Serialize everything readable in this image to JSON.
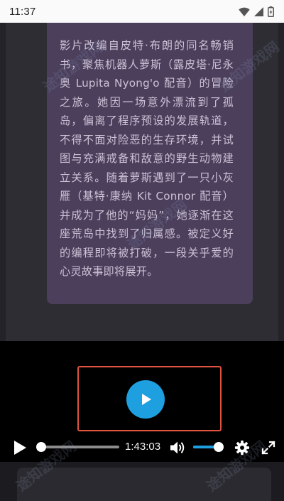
{
  "status_bar": {
    "time": "11:37",
    "icons": [
      "wifi-icon",
      "signal-icon",
      "battery-icon"
    ]
  },
  "description": {
    "text": "影片改编自皮特·布朗的同名畅销书，聚焦机器人萝斯（露皮塔·尼永奥 Lupita Nyong'o 配音）的冒险之旅。她因一场意外漂流到了孤岛，偏离了程序预设的发展轨道，不得不面对险恶的生存环境，并试图与充满戒备和敌意的野生动物建立关系。随着萝斯遇到了一只小灰雁（基特·康纳 Kit Connor 配音）并成为了他的“妈妈”，她逐渐在这座荒岛中找到了归属感。被定义好的编程即将被打破，一段关乎爱的心灵故事即将展开。"
  },
  "player": {
    "duration": "1:43:03",
    "progress": 0.0,
    "volume": 0.9,
    "accent_color": "#1ea0e0",
    "highlight_color": "#e0533f",
    "icons": [
      "play-icon",
      "volume-icon",
      "gear-icon",
      "fullscreen-icon"
    ]
  },
  "watermark": "途知游戏网"
}
